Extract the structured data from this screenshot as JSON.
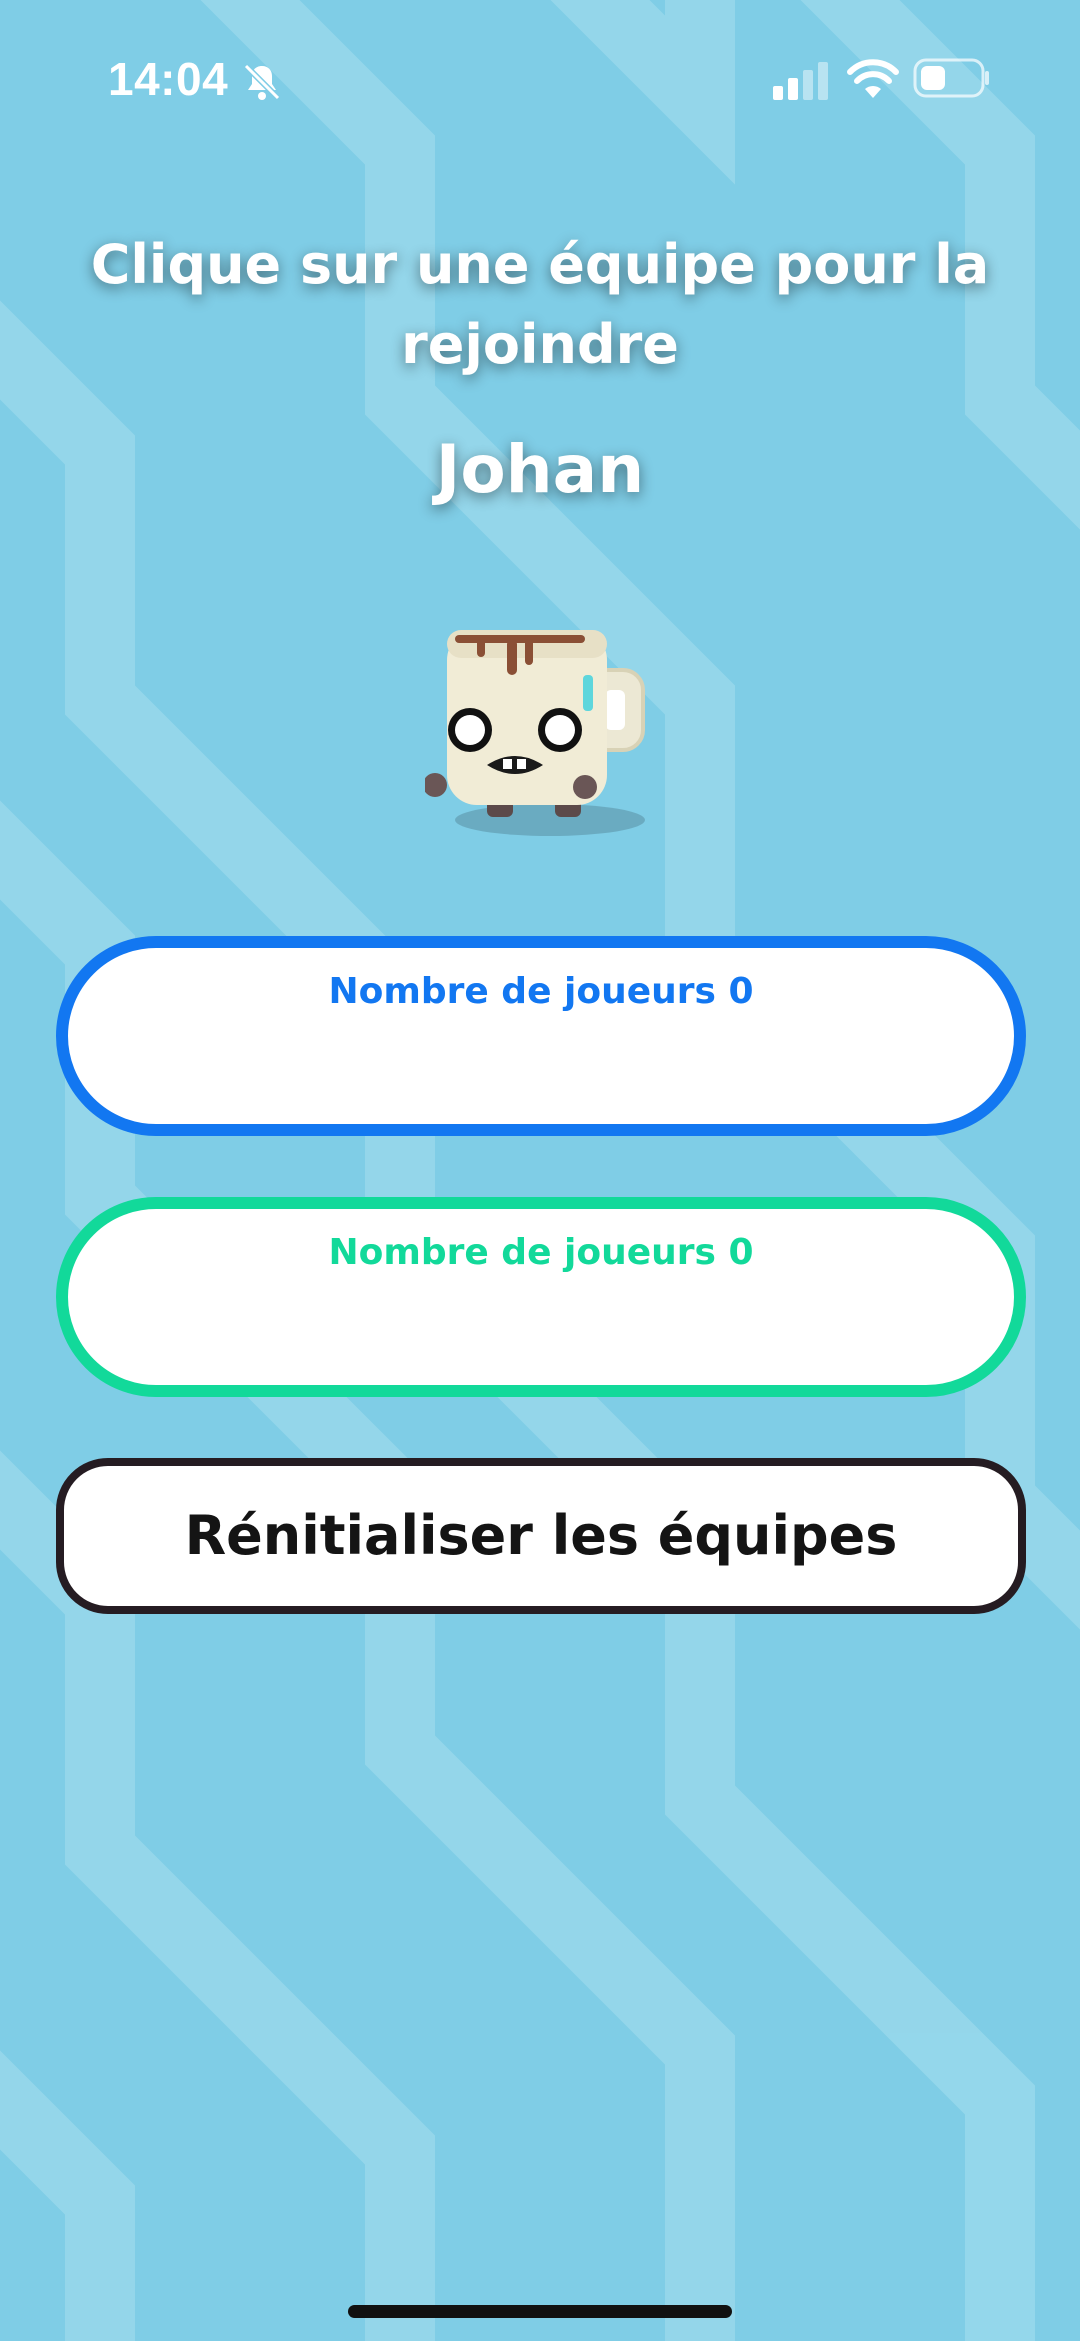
{
  "status_bar": {
    "time": "14:04",
    "icons": [
      "bell-slash-icon",
      "cellular-signal-icon",
      "wifi-icon",
      "battery-icon"
    ]
  },
  "screen": {
    "title": "Clique sur une équipe pour la rejoindre",
    "player_name": "Johan",
    "avatar": "mug-character"
  },
  "teams": [
    {
      "count_label": "Nombre de joueurs 0",
      "color": "#1277f1"
    },
    {
      "count_label": "Nombre de joueurs 0",
      "color": "#12d99a"
    }
  ],
  "reset_button": {
    "label": "Rénitialiser les équipes"
  },
  "colors": {
    "background": "#7fcde6",
    "background_stripe": "#9ad9ec",
    "text_dark": "#141414"
  }
}
